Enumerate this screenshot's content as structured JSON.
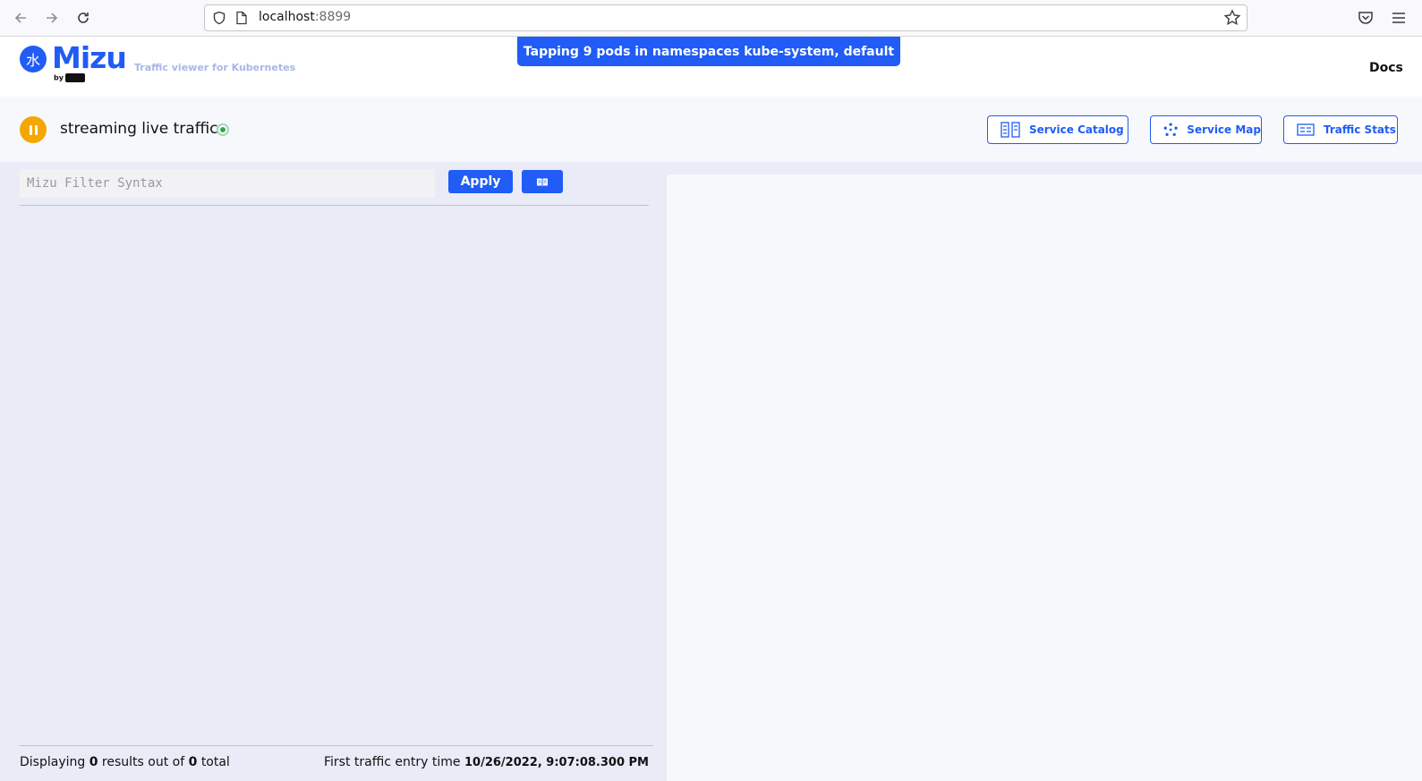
{
  "browser": {
    "url_host": "localhost",
    "url_port": ":8899"
  },
  "header": {
    "logo_glyph": "水",
    "logo_text": "Mizu",
    "logo_by": "by",
    "subtitle": "Traffic viewer for Kubernetes",
    "tapping_banner": "Tapping 9 pods in namespaces kube-system, default",
    "docs_label": "Docs"
  },
  "controls": {
    "status_text": "streaming live traffic",
    "service_catalog_label": "Service Catalog",
    "service_map_label": "Service Map",
    "traffic_stats_label": "Traffic Stats"
  },
  "filter": {
    "placeholder": "Mizu Filter Syntax",
    "value": "",
    "apply_label": "Apply"
  },
  "footer": {
    "displaying_prefix": "Displaying",
    "results_count": "0",
    "results_mid": "results out of",
    "total_count": "0",
    "total_suffix": "total",
    "first_entry_label": "First traffic entry time",
    "first_entry_time": "10/26/2022, 9:07:08.300 PM"
  },
  "colors": {
    "brand": "#205cf5",
    "pause": "#f4a700",
    "live": "#2fa84f"
  }
}
